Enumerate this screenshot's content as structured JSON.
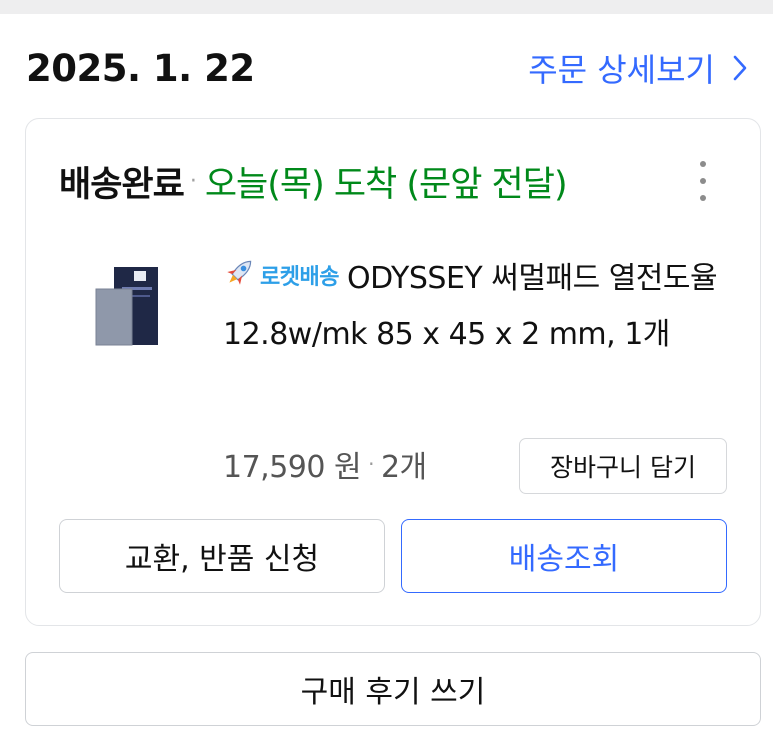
{
  "order": {
    "date": "2025. 1. 22",
    "detail_link_label": "주문 상세보기"
  },
  "card": {
    "status": "배송완료",
    "arrival": "오늘(목) 도착 (문앞 전달)",
    "rocket_label": "로켓배송",
    "product_name": "ODYSSEY 써멀패드 열전도율 12.8w/mk 85 x 45 x 2 mm, 1개",
    "price": "17,590 원",
    "quantity": "2개",
    "cart_button": "장바구니 담기",
    "exchange_button": "교환, 반품 신청",
    "track_button": "배송조회"
  },
  "review_button": "구매 후기 쓰기",
  "colors": {
    "accent": "#346aff",
    "arrival_green": "#00891a",
    "rocket_blue": "#2d9fe8"
  },
  "icons": [
    "chevron-right-icon",
    "more-vertical-icon",
    "rocket-icon",
    "product-thumbnail"
  ]
}
